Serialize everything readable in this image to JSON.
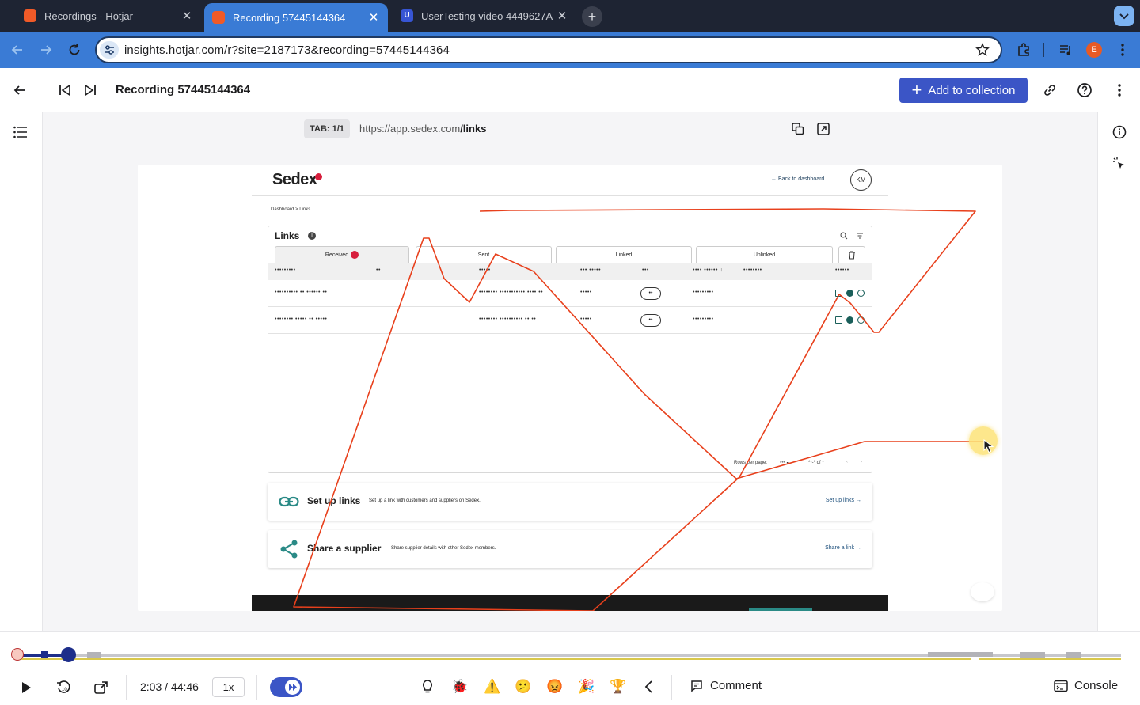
{
  "browser": {
    "tabs": [
      {
        "title": "Recordings - Hotjar",
        "favicon": "hotjar-icon",
        "active": false
      },
      {
        "title": "Recording 57445144364",
        "favicon": "hotjar-icon",
        "active": true
      },
      {
        "title": "UserTesting video 4449627A",
        "favicon": "usertesting-icon",
        "active": false
      }
    ],
    "url": "insights.hotjar.com/r?site=2187173&recording=57445144364",
    "profile_initial": "E"
  },
  "header": {
    "title": "Recording 57445144364",
    "add_to_collection": "Add to collection"
  },
  "recording_bar": {
    "tab_label": "TAB: 1/1",
    "page_url_prefix": "https://app.sedex.com",
    "page_url_path": "/links"
  },
  "sedex": {
    "logo": "Sedex",
    "back_link": "Back to dashboard",
    "user_initials": "KM",
    "breadcrumb": "Dashboard  >  Links",
    "card_title": "Links",
    "tabs": [
      "Received",
      "Sent",
      "Linked",
      "Unlinked"
    ],
    "masked_header": [
      "•••••••••",
      "••",
      "•••••",
      "••• •••••",
      "•••",
      "•••• •••••• ↓",
      "••••••••",
      "••••••"
    ],
    "rows": [
      {
        "c1": "•••••••••• •• •••••• ••",
        "c2": "•••••••• ••••••••••• •••• ••",
        "c3": "•••••",
        "c4": "•••••••••"
      },
      {
        "c1": "•••••••• ••••• •• •••••",
        "c2": "•••••••• •••••••••• •• ••",
        "c3": "•••••",
        "c4": "•••••••••"
      }
    ],
    "rows_per_page": "Rows per page:",
    "rows_value": "*** ▾",
    "pagination": "**-* of *",
    "panels": [
      {
        "title": "Set up links",
        "desc": "Set up a link with customers and suppliers on Sedex.",
        "link": "Set up links →",
        "icon": "link-icon"
      },
      {
        "title": "Share a supplier",
        "desc": "Share supplier details with other Sedex members.",
        "link": "Share a link →",
        "icon": "share-icon"
      }
    ]
  },
  "player": {
    "time": "2:03 / 44:46",
    "speed": "1x",
    "progress_fraction": 0.046,
    "comment": "Comment",
    "console": "Console",
    "event_icons": [
      "lightbulb-icon",
      "bug-icon",
      "warning-icon",
      "confused-face-icon",
      "angry-face-icon",
      "party-popper-icon",
      "trophy-icon"
    ]
  },
  "colors": {
    "accent": "#3b55c6",
    "browser_blue": "#3a7bd5",
    "trail": "#e8401c",
    "sedex_red": "#d71e3c"
  }
}
